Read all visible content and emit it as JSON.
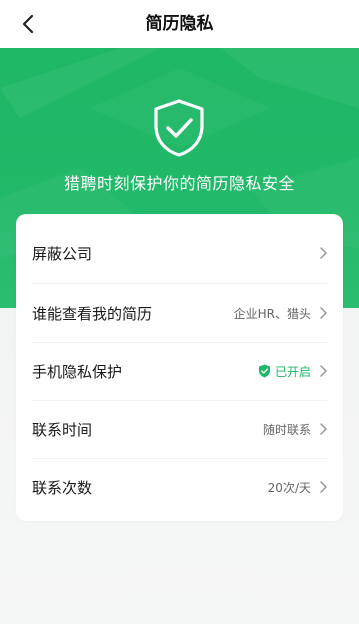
{
  "header": {
    "title": "简历隐私",
    "back_icon": "chevron-left-icon"
  },
  "hero": {
    "icon": "shield-check-icon",
    "tagline": "猎聘时刻保护你的简历隐私安全",
    "color": "#1fb866"
  },
  "settings": [
    {
      "label": "屏蔽公司",
      "value": "",
      "value_color": "#666666"
    },
    {
      "label": "谁能查看我的简历",
      "value": "企业HR、猎头",
      "value_color": "#666666"
    },
    {
      "label": "手机隐私保护",
      "value": "已开启",
      "value_color": "#1fb866",
      "value_icon": "shield-check-icon"
    },
    {
      "label": "联系时间",
      "value": "随时联系",
      "value_color": "#666666"
    },
    {
      "label": "联系次数",
      "value": "20次/天",
      "value_color": "#666666"
    }
  ]
}
